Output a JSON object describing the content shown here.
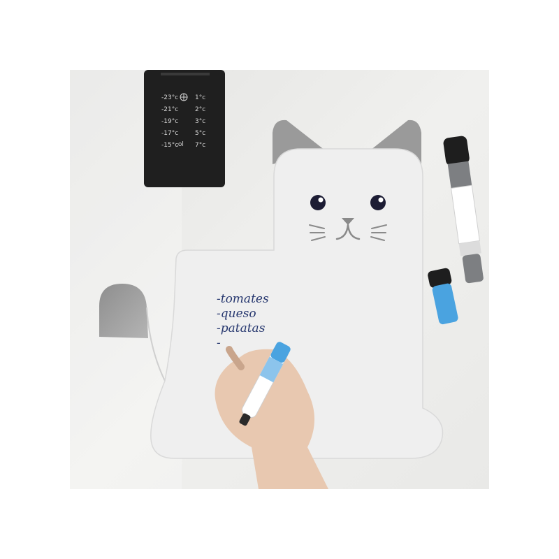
{
  "fridge_panel": {
    "freezer_temps": [
      "-23°c",
      "-21°c",
      "-19°c",
      "-17°c",
      "-15°c"
    ],
    "fridge_temps": [
      "1°c",
      "2°c",
      "3°c",
      "5°c",
      "7°c"
    ]
  },
  "whiteboard": {
    "list_items": [
      "-tomates",
      "-queso",
      "-patatas",
      "-"
    ]
  },
  "colors": {
    "background": "#ffffff",
    "fridge_door": "#eeeeec",
    "board": "#efefef",
    "ears": "#9a9a9a",
    "ink": "#25366e",
    "marker_blue": "#4aa3e0",
    "marker_gray": "#808285"
  },
  "icons": [
    "snowflake-icon",
    "cat-face"
  ]
}
